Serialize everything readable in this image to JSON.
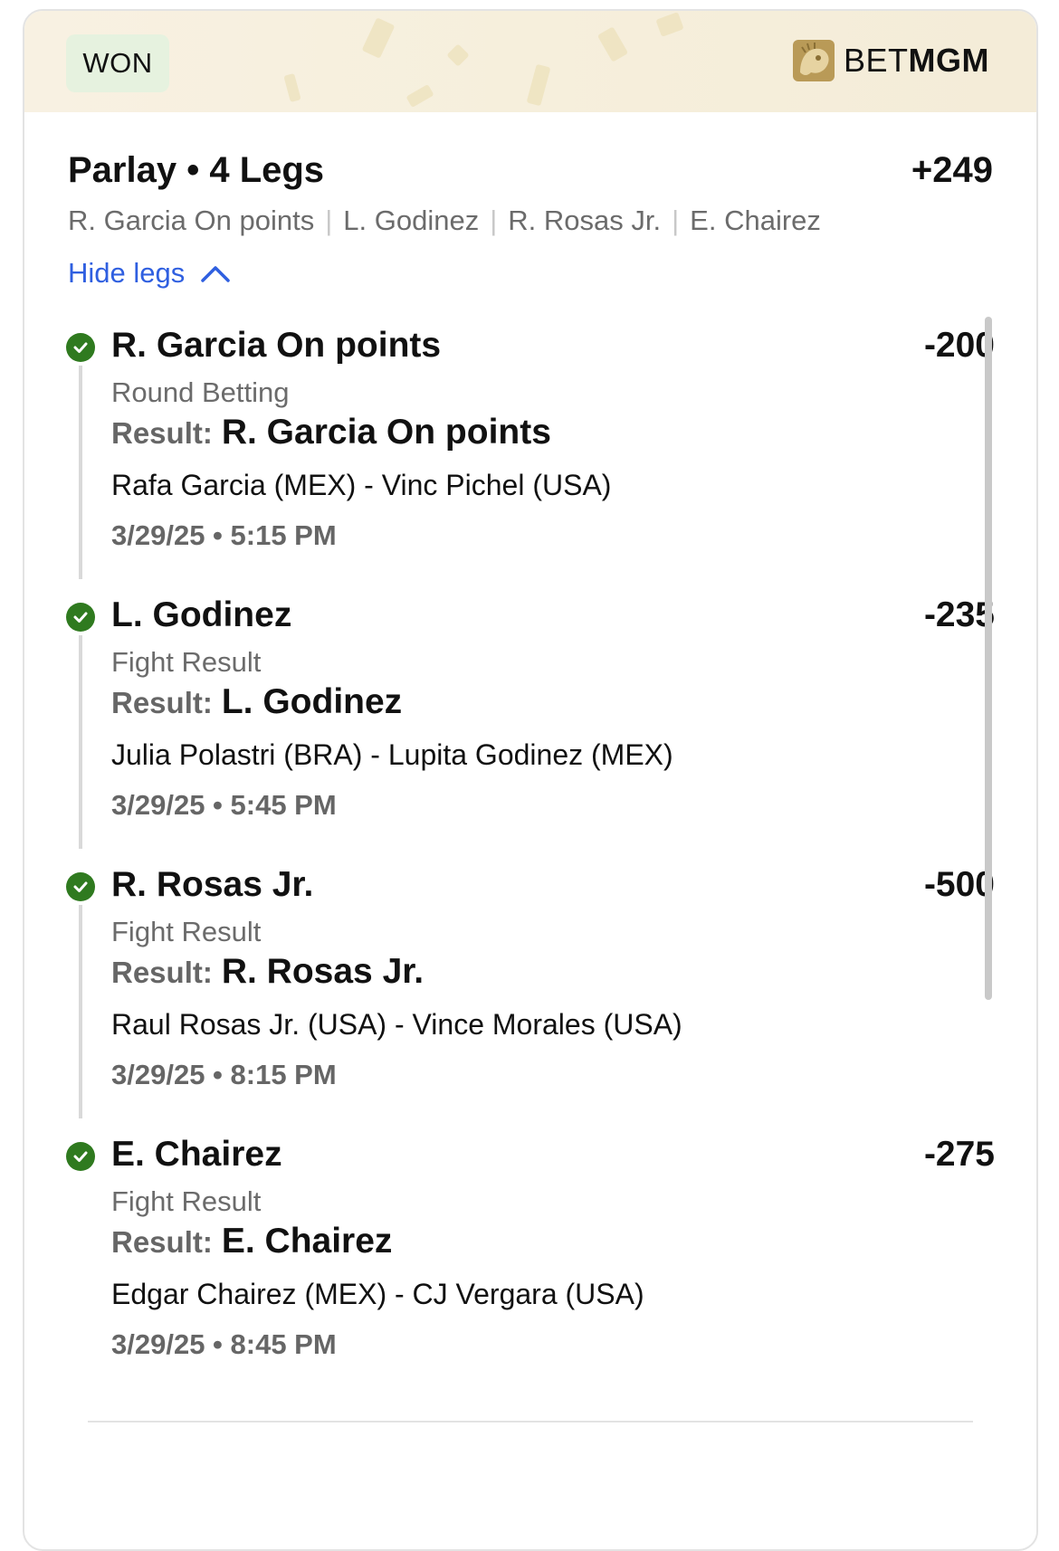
{
  "status_badge": "WON",
  "brand": {
    "part1": "BET",
    "part2": "MGM"
  },
  "bet": {
    "title": "Parlay • 4 Legs",
    "odds": "+249",
    "summary": [
      "R. Garcia On points",
      "L. Godinez",
      "R. Rosas Jr.",
      "E. Chairez"
    ],
    "toggle_label": "Hide legs"
  },
  "result_label": "Result:",
  "legs": [
    {
      "name": "R. Garcia On points",
      "odds": "-200",
      "market": "Round Betting",
      "result": "R. Garcia On points",
      "event": "Rafa Garcia (MEX) - Vinc Pichel (USA)",
      "time": "3/29/25 • 5:15 PM"
    },
    {
      "name": "L. Godinez",
      "odds": "-235",
      "market": "Fight Result",
      "result": "L. Godinez",
      "event": "Julia Polastri (BRA) - Lupita Godinez (MEX)",
      "time": "3/29/25 • 5:45 PM"
    },
    {
      "name": "R. Rosas Jr.",
      "odds": "-500",
      "market": "Fight Result",
      "result": "R. Rosas Jr.",
      "event": "Raul Rosas Jr. (USA) - Vince Morales (USA)",
      "time": "3/29/25 • 8:15 PM"
    },
    {
      "name": "E. Chairez",
      "odds": "-275",
      "market": "Fight Result",
      "result": "E. Chairez",
      "event": "Edgar Chairez (MEX) - CJ Vergara (USA)",
      "time": "3/29/25 • 8:45 PM"
    }
  ],
  "colors": {
    "won_bg": "#e6f2df",
    "check": "#2f7a1f",
    "link": "#2f5fe0",
    "header_bg": "#f6efdc"
  }
}
